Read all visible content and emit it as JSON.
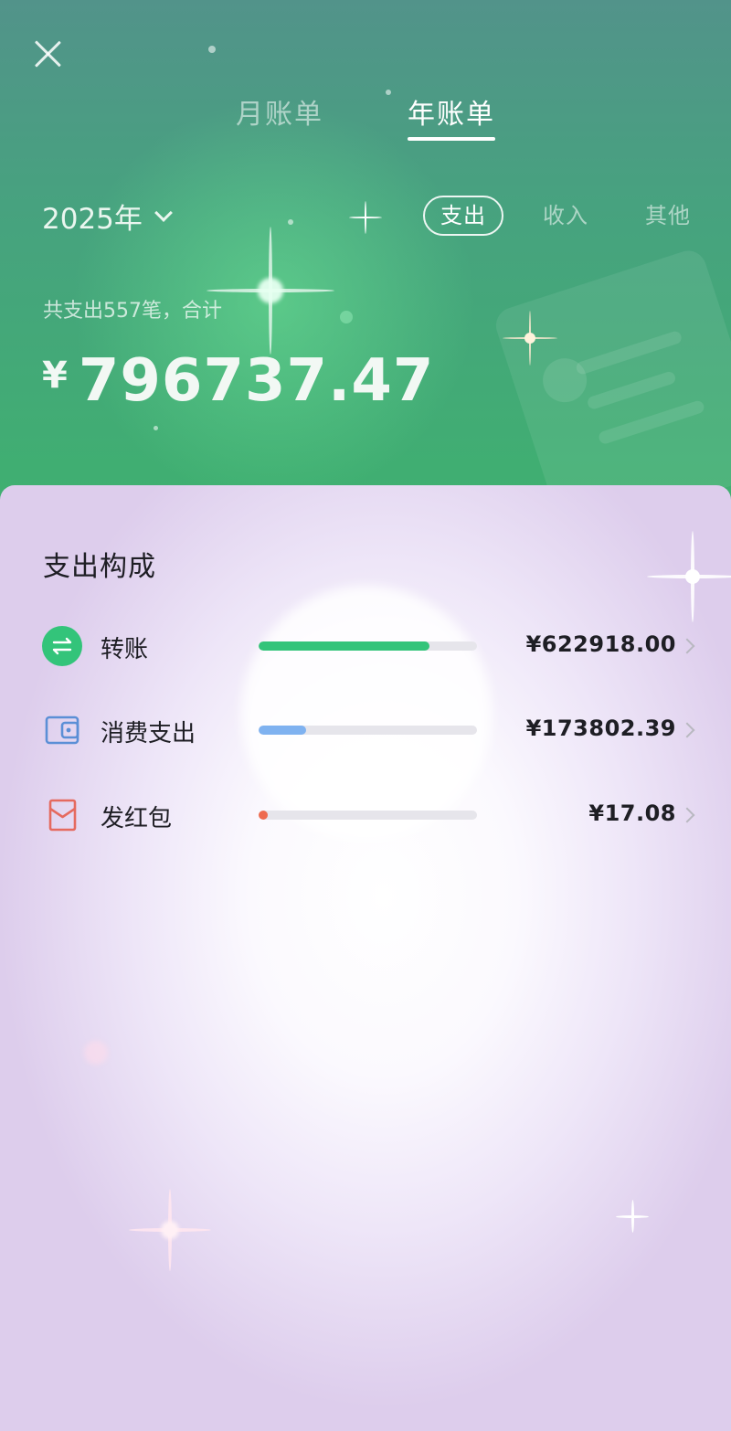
{
  "header": {
    "tabs": [
      {
        "label": "月账单",
        "active": false
      },
      {
        "label": "年账单",
        "active": true
      }
    ],
    "year": "2025年",
    "filters": [
      {
        "label": "支出",
        "active": true
      },
      {
        "label": "收入",
        "active": false
      },
      {
        "label": "其他",
        "active": false
      }
    ],
    "summary": "共支出557笔，合计",
    "currency": "¥",
    "total": "796737.47"
  },
  "panel": {
    "title": "支出构成",
    "items": [
      {
        "label": "转账",
        "amount": "¥622918.00",
        "share": 0.782,
        "color": "#33c47a",
        "icon": "transfer-icon"
      },
      {
        "label": "消费支出",
        "amount": "¥173802.39",
        "share": 0.218,
        "color": "#7fb2f0",
        "icon": "wallet-icon"
      },
      {
        "label": "发红包",
        "amount": "¥17.08",
        "share": 2e-05,
        "color": "#ee6a4e",
        "icon": "red-envelope-icon"
      }
    ]
  },
  "colors": {
    "header_green": "#3fb070",
    "transfer_green": "#33c47a",
    "wallet_blue": "#5b8fd6",
    "envelope_red": "#e56a5f"
  }
}
